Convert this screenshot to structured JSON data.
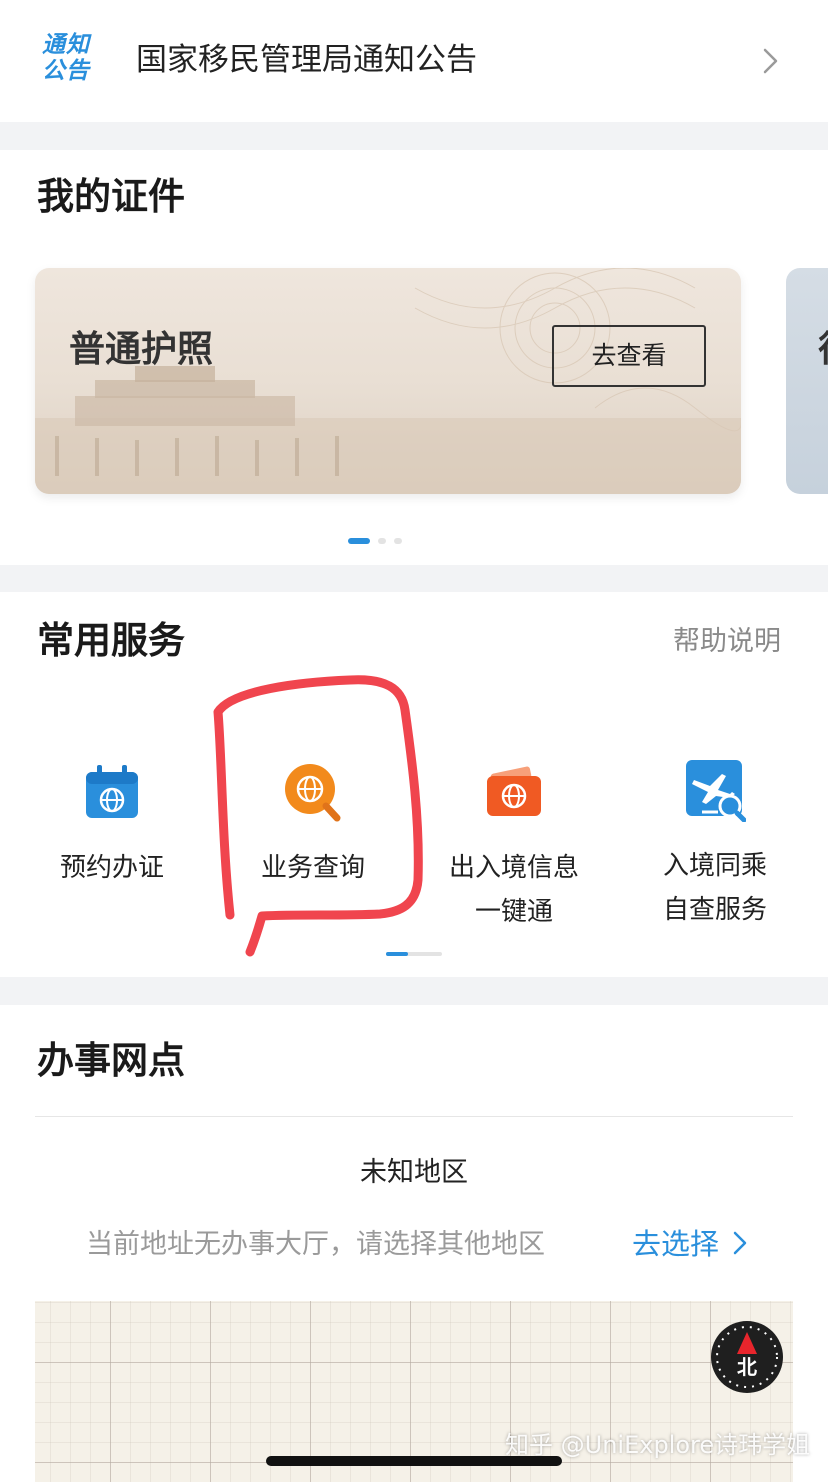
{
  "notice": {
    "logo_line1": "通知",
    "logo_line2": "公告",
    "text": "国家移民管理局通知公告",
    "chevron_icon": "chevron-right-icon"
  },
  "my_documents": {
    "title": "我的证件",
    "cards": [
      {
        "name": "普通护照",
        "button_label": "去查看"
      },
      {
        "name": "往"
      }
    ],
    "pager": {
      "active_index": 0,
      "count": 3
    }
  },
  "services": {
    "title": "常用服务",
    "help_label": "帮助说明",
    "items": [
      {
        "icon": "calendar-globe-icon",
        "line1": "预约办证",
        "line2": "",
        "color": "#2a8fdc"
      },
      {
        "icon": "globe-search-icon",
        "line1": "业务查询",
        "line2": "",
        "color": "#f28a1c",
        "highlighted": true
      },
      {
        "icon": "wallet-globe-icon",
        "line1": "出入境信息",
        "line2": "一键通",
        "color": "#f05a23"
      },
      {
        "icon": "plane-search-icon",
        "line1": "入境同乘",
        "line2": "自查服务",
        "color": "#2a8fdc"
      }
    ],
    "scroll_position": 0.4
  },
  "offices": {
    "title": "办事网点",
    "region": "未知地区",
    "no_hall_text": "当前地址无办事大厅，请选择其他地区",
    "choose_label": "去选择",
    "choose_icon": "chevron-right-icon",
    "compass_label": "北"
  },
  "colors": {
    "accent": "#2a8fdc",
    "orange": "#f28a1c",
    "red_orange": "#f05a23",
    "annotation_red": "#f0454e"
  },
  "watermark": "知乎 @UniExplore诗玮学姐"
}
